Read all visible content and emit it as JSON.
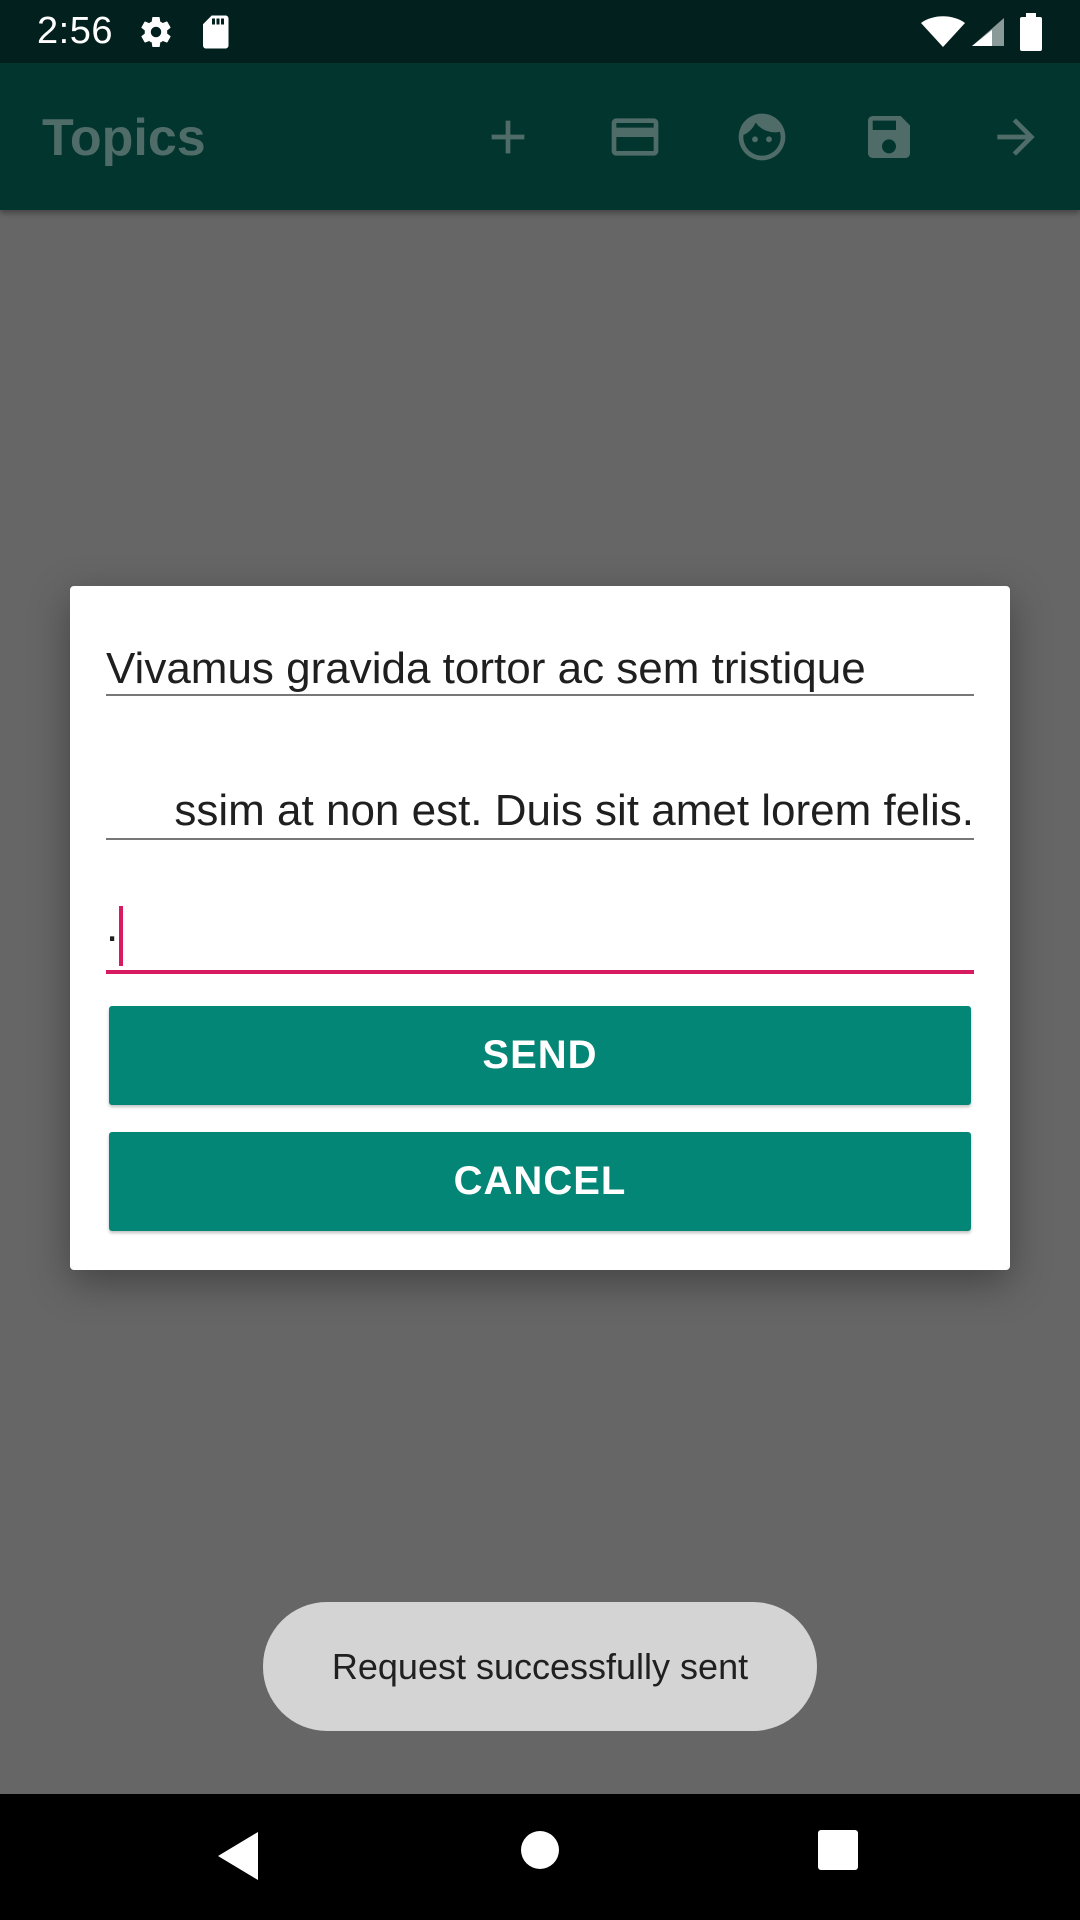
{
  "status_bar": {
    "time": "2:56",
    "icons": [
      "gear-icon",
      "sd-card-icon",
      "wifi-icon",
      "signal-icon",
      "battery-icon"
    ]
  },
  "app_bar": {
    "title": "Topics",
    "actions": [
      "add-icon",
      "credit-card-icon",
      "face-icon",
      "save-icon",
      "arrow-forward-icon"
    ]
  },
  "dialog": {
    "field1_value": "Vivamus gravida tortor ac sem tristique",
    "field2_value": "ssim at non est. Duis sit amet lorem felis.",
    "field3_value": ".",
    "send_label": "SEND",
    "cancel_label": "CANCEL"
  },
  "toast": {
    "message": "Request successfully sent"
  },
  "colors": {
    "status_bar_bg": "#02201d",
    "app_bar_bg": "#03352f",
    "button_bg": "#048677",
    "accent": "#d81b60",
    "scrim": "#666666",
    "toast_bg": "#d4d4d4"
  }
}
